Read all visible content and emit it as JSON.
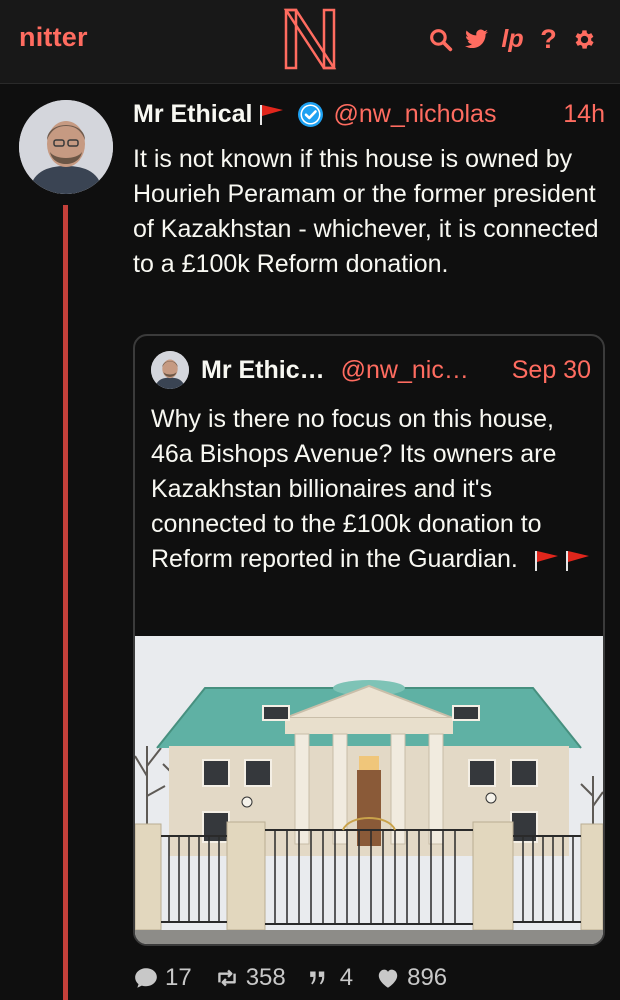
{
  "nav": {
    "brand": "nitter",
    "logo_letter": "N",
    "icons": [
      "search-icon",
      "twitter-icon",
      "liberapay-icon",
      "help-icon",
      "settings-icon"
    ],
    "liberapay_text": "lp",
    "help_text": "?"
  },
  "tweet": {
    "fullname": "Mr Ethical",
    "username": "@nw_nicholas",
    "date": "14h",
    "text": "It is not known if this house is owned by Hourieh Peramam or the former president of Kazakhstan - whichever, it is connected to a £100k Reform donation.",
    "verified": true
  },
  "quote": {
    "fullname": "Mr Ethic…",
    "username": "@nw_nic…",
    "date": "Sep 30",
    "text": "Why is there no focus on this house, 46a Bishops Avenue? Its owners are Kazakhstan billionaires and it's connected to the £100k donation to Reform reported in the Guardian."
  },
  "stats": {
    "replies": "17",
    "retweets": "358",
    "quotes": "4",
    "likes": "896"
  },
  "colors": {
    "accent": "#ff6c60",
    "background": "#0f0f0f",
    "navbar": "#181818",
    "rail": "#c4403a",
    "verified": "#1da1f2"
  }
}
